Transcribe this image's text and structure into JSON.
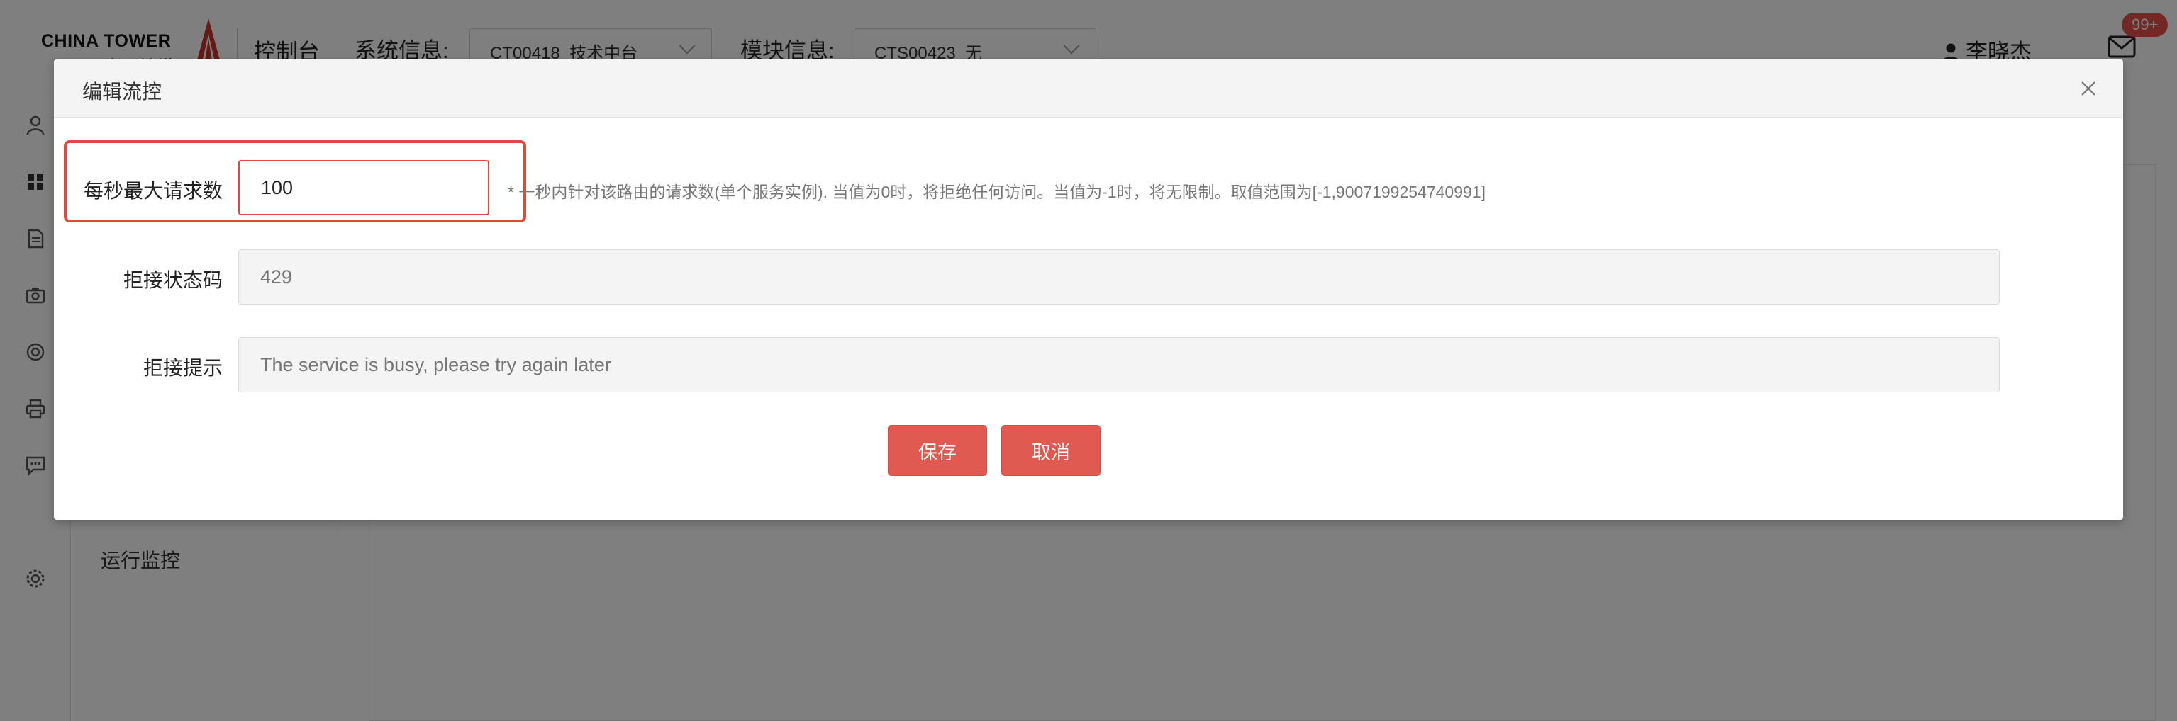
{
  "header": {
    "logo_text_line1": "CHINA TOWER",
    "logo_text_line2": "中国铁塔",
    "console": "控制台",
    "system_label": "系统信息:",
    "system_value": "CT00418_技术中台",
    "module_label": "模块信息:",
    "module_value": "CTS00423_无",
    "user_name": "李晓杰",
    "notification_count": "99+"
  },
  "sidebar": {
    "icons": [
      "user-icon",
      "grid-icon",
      "document-icon",
      "camera-icon",
      "lifebuoy-icon",
      "printer-icon",
      "chat-icon",
      "settings-icon"
    ],
    "subnav_item": "运行监控"
  },
  "modal": {
    "title": "编辑流控",
    "fields": {
      "rate": {
        "label": "每秒最大请求数",
        "value": "100",
        "hint": "* 一秒内针对该路由的请求数(单个服务实例). 当值为0时，将拒绝任何访问。当值为-1时，将无限制。取值范围为[-1,9007199254740991]"
      },
      "status_code": {
        "label": "拒接状态码",
        "placeholder": "429"
      },
      "message": {
        "label": "拒接提示",
        "placeholder": "The service is busy, please try again later"
      }
    },
    "save_label": "保存",
    "cancel_label": "取消"
  },
  "colors": {
    "accent": "#e04a3b",
    "button": "#e05a51",
    "overlay": "rgba(0,0,0,0.5)"
  }
}
